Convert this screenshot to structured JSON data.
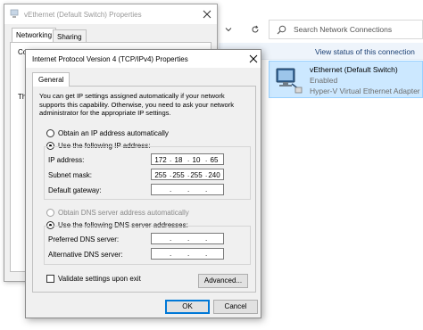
{
  "network_connections": {
    "search_placeholder": "Search Network Connections",
    "command_partial": "connection",
    "command_status": "View status of this connection",
    "adapter": {
      "name": "vEthernet (Default Switch)",
      "status": "Enabled",
      "description": "Hyper-V Virtual Ethernet Adapter"
    }
  },
  "properties_window": {
    "title": "vEthernet (Default Switch) Properties",
    "tabs": [
      "Networking",
      "Sharing"
    ],
    "fragments": [
      "Conne",
      "Th"
    ]
  },
  "ipv4_dialog": {
    "title": "Internet Protocol Version 4 (TCP/IPv4) Properties",
    "tab": "General",
    "intro": "You can get IP settings assigned automatically if your network supports this capability. Otherwise, you need to ask your network administrator for the appropriate IP settings.",
    "obtain_ip_auto": "Obtain an IP address automatically",
    "use_following_ip": "Use the following IP address:",
    "ip_label": "IP address:",
    "ip_octets": [
      "172",
      "18",
      "10",
      "65"
    ],
    "subnet_label": "Subnet mask:",
    "subnet_octets": [
      "255",
      "255",
      "255",
      "240"
    ],
    "gateway_label": "Default gateway:",
    "obtain_dns_auto": "Obtain DNS server address automatically",
    "use_following_dns": "Use the following DNS server addresses:",
    "preferred_dns_label": "Preferred DNS server:",
    "alternate_dns_label": "Alternative DNS server:",
    "validate_label": "Validate settings upon exit",
    "advanced_button": "Advanced...",
    "ok_button": "OK",
    "cancel_button": "Cancel",
    "selected_ip_mode": "manual",
    "selected_dns_mode": "manual",
    "validate_checked": false
  },
  "colors": {
    "selection_fill": "#cce8ff",
    "selection_border": "#99d1ff",
    "link_text": "#1a3f73",
    "default_button_border": "#0078d7"
  },
  "icons": [
    "search-icon",
    "refresh-icon",
    "chevron-down-icon",
    "network-adapter-icon",
    "close-icon"
  ]
}
